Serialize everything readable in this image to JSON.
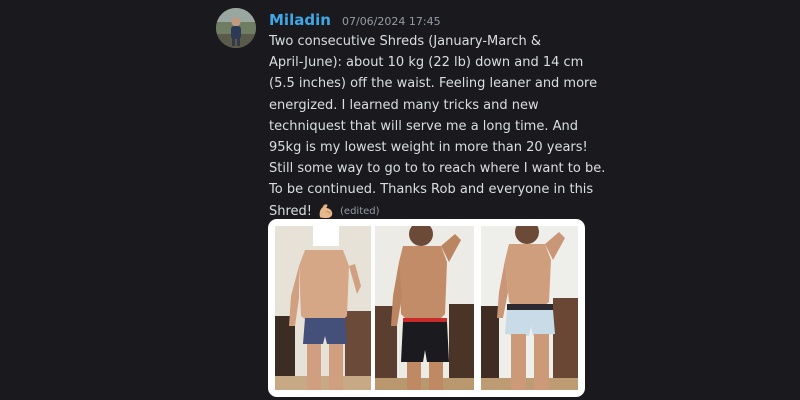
{
  "message": {
    "author": "Miladin",
    "timestamp": "07/06/2024 17:45",
    "lines": [
      "Two consecutive Shreds (January-March &",
      "April-June): about  10 kg (22 lb) down and 14 cm",
      "(5.5 inches) off the waist. Feeling leaner and more",
      "energized. I learned many tricks and new",
      "techniquest that will serve me a long time. And",
      "95kg is my lowest weight in more than 20 years!",
      "Still some way to go to to reach where I want to be.",
      "To be continued. Thanks Rob and everyone in this"
    ],
    "last_line": "Shred!",
    "emoji": "flexed-biceps-icon",
    "edited_label": "(edited)"
  },
  "attachment": {
    "photos": [
      "progress-photo-1",
      "progress-photo-2",
      "progress-photo-3"
    ]
  },
  "colors": {
    "background": "#1a1a1e",
    "username": "#3fa7e6",
    "text": "#dbdee1",
    "muted": "#949ba4"
  }
}
